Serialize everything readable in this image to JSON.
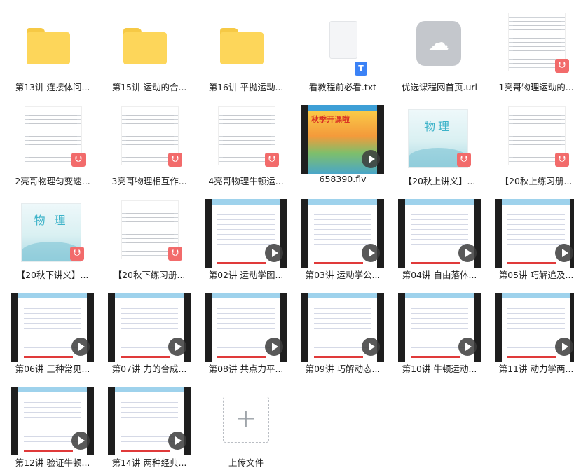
{
  "files": [
    {
      "kind": "folder",
      "name": "第13讲 连接体问..."
    },
    {
      "kind": "folder",
      "name": "第15讲 运动的合..."
    },
    {
      "kind": "folder",
      "name": "第16讲 平抛运动..."
    },
    {
      "kind": "txt",
      "name": "看教程前必看.txt",
      "badge": "T"
    },
    {
      "kind": "url",
      "name": "优选课程网首页.url"
    },
    {
      "kind": "pdf",
      "name": "1亮哥物理运动的..."
    },
    {
      "kind": "pdf",
      "name": "2亮哥物理匀变速..."
    },
    {
      "kind": "pdf",
      "name": "3亮哥物理相互作..."
    },
    {
      "kind": "pdf",
      "name": "4亮哥物理牛顿运..."
    },
    {
      "kind": "video",
      "name": "658390.flv",
      "banner": "秋季开课啦"
    },
    {
      "kind": "pdf-cover",
      "name": "【20秋上讲义】...",
      "cover_title": "物理"
    },
    {
      "kind": "pdf",
      "name": "【20秋上练习册..."
    },
    {
      "kind": "pdf-cover",
      "name": "【20秋下讲义】...",
      "cover_title": "物 理"
    },
    {
      "kind": "pdf",
      "name": "【20秋下练习册..."
    },
    {
      "kind": "video",
      "name": "第02讲 运动学图..."
    },
    {
      "kind": "video",
      "name": "第03讲 运动学公..."
    },
    {
      "kind": "video",
      "name": "第04讲 自由落体..."
    },
    {
      "kind": "video",
      "name": "第05讲 巧解追及..."
    },
    {
      "kind": "video",
      "name": "第06讲 三种常见..."
    },
    {
      "kind": "video",
      "name": "第07讲 力的合成..."
    },
    {
      "kind": "video",
      "name": "第08讲 共点力平..."
    },
    {
      "kind": "video",
      "name": "第09讲 巧解动态..."
    },
    {
      "kind": "video",
      "name": "第10讲 牛顿运动..."
    },
    {
      "kind": "video",
      "name": "第11讲 动力学两..."
    },
    {
      "kind": "video",
      "name": "第12讲 验证牛顿..."
    },
    {
      "kind": "video",
      "name": "第14讲 两种经典..."
    },
    {
      "kind": "upload",
      "name": "上传文件",
      "symbol": "+"
    }
  ],
  "icons": {
    "pdf_badge": "⮋",
    "cloud": "☁"
  },
  "colors": {
    "folder": "#fdd65a",
    "pdf": "#f26b6b",
    "txt": "#3b82f6"
  }
}
